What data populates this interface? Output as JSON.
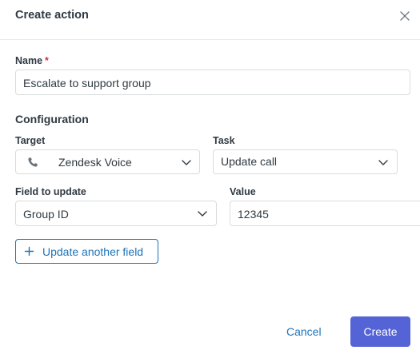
{
  "header": {
    "title": "Create action"
  },
  "name_field": {
    "label": "Name",
    "required_mark": "*",
    "value": "Escalate to support group"
  },
  "configuration": {
    "title": "Configuration"
  },
  "target": {
    "label": "Target",
    "value": "Zendesk Voice",
    "icon": "phone-icon"
  },
  "task": {
    "label": "Task",
    "value": "Update call"
  },
  "field_to_update": {
    "label": "Field to update",
    "value": "Group ID"
  },
  "value_field": {
    "label": "Value",
    "value": "12345"
  },
  "add_field_button": {
    "label": "Update another field",
    "icon": "plus-icon"
  },
  "footer": {
    "cancel_label": "Cancel",
    "create_label": "Create"
  },
  "colors": {
    "accent": "#1f73b7",
    "primary_button": "#5464d7",
    "required": "#cc3340",
    "border": "#d8dcde"
  }
}
